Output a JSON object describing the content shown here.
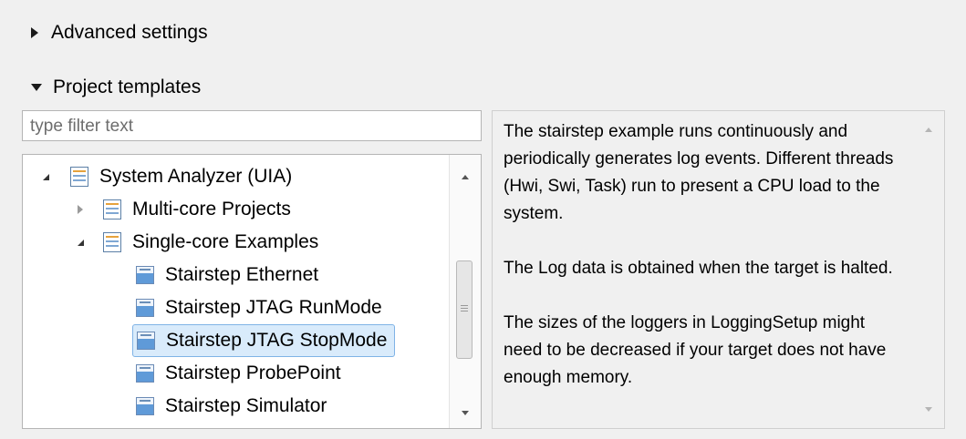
{
  "sections": {
    "advanced": {
      "label": "Advanced settings",
      "expanded": false
    },
    "templates": {
      "label": "Project templates",
      "expanded": true
    }
  },
  "filter": {
    "placeholder": "type filter text"
  },
  "tree": {
    "items": [
      {
        "label": "System Analyzer (UIA)",
        "expanded": true
      },
      {
        "label": "Multi-core Projects",
        "expanded": false
      },
      {
        "label": "Single-core Examples",
        "expanded": true
      },
      {
        "label": "Stairstep Ethernet"
      },
      {
        "label": "Stairstep JTAG RunMode"
      },
      {
        "label": "Stairstep JTAG StopMode",
        "selected": true
      },
      {
        "label": "Stairstep ProbePoint"
      },
      {
        "label": "Stairstep Simulator"
      }
    ]
  },
  "description": {
    "paragraphs": [
      "The stairstep example runs continuously and periodically generates log events. Different threads (Hwi, Swi, Task) run to present a CPU load to the system.",
      "The Log data is obtained when the target is halted.",
      "The sizes of the loggers in LoggingSetup might need to be decreased if your target does not have enough memory."
    ]
  }
}
